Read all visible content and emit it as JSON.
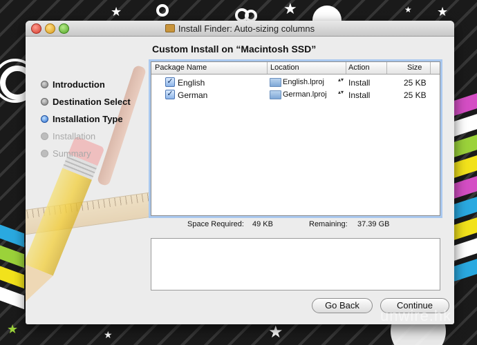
{
  "window": {
    "title": "Install Finder: Auto-sizing columns"
  },
  "steps": [
    {
      "label": "Introduction",
      "state": "done"
    },
    {
      "label": "Destination Select",
      "state": "done"
    },
    {
      "label": "Installation Type",
      "state": "active"
    },
    {
      "label": "Installation",
      "state": "future"
    },
    {
      "label": "Summary",
      "state": "future"
    }
  ],
  "content": {
    "heading": "Custom Install on “Macintosh SSD”",
    "columns": [
      "Package Name",
      "Location",
      "Action",
      "Size"
    ],
    "rows": [
      {
        "name": "English",
        "location": "English.lproj",
        "action": "Install",
        "size": "25 KB",
        "checked": true
      },
      {
        "name": "German",
        "location": "German.lproj",
        "action": "Install",
        "size": "25 KB",
        "checked": true
      }
    ],
    "space_required_label": "Space Required:",
    "space_required_value": "49 KB",
    "remaining_label": "Remaining:",
    "remaining_value": "37.39 GB"
  },
  "buttons": {
    "back": "Go Back",
    "continue": "Continue"
  },
  "watermark": "unwire.hk",
  "icons": {
    "check": "✓",
    "updown": "▴▾"
  },
  "colors": {
    "active_step": "#2c6fd1",
    "focus_ring": "#a9c8ef"
  }
}
